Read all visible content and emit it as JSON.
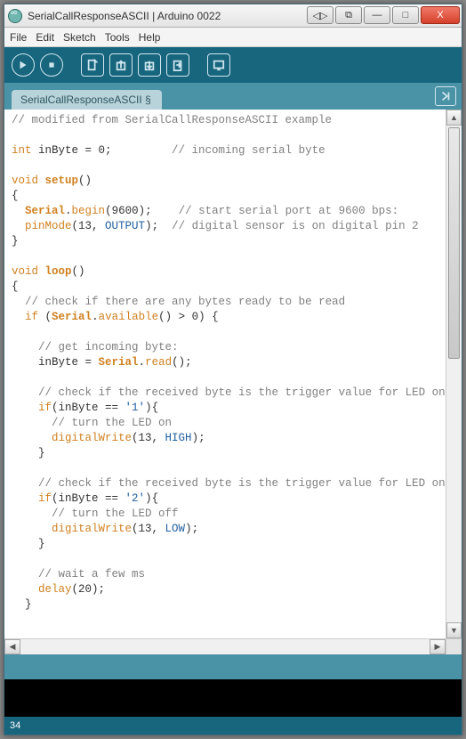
{
  "window": {
    "title": "SerialCallResponseASCII | Arduino 0022"
  },
  "menubar": {
    "file": "File",
    "edit": "Edit",
    "sketch": "Sketch",
    "tools": "Tools",
    "help": "Help"
  },
  "win_buttons": {
    "shrink": "◁▷",
    "expand": "⧉",
    "min": "—",
    "max": "□",
    "close": "X"
  },
  "toolbar_icons": {
    "run": "run-icon",
    "stop": "stop-icon",
    "new": "new-icon",
    "open": "open-icon",
    "save": "save-icon",
    "upload": "upload-icon",
    "serial": "serial-monitor-icon"
  },
  "tab": {
    "label": "SerialCallResponseASCII §"
  },
  "code": {
    "l1": "// modified from SerialCallResponseASCII example",
    "l2_a": "int",
    "l2_b": " inByte = 0;         ",
    "l2_c": "// incoming serial byte",
    "l3_a": "void",
    "l3_b": "setup",
    "l3_c": "()",
    "l4": "{",
    "l5_a": "Serial",
    "l5_b": ".",
    "l5_c": "begin",
    "l5_d": "(9600);    ",
    "l5_e": "// start serial port at 9600 bps:",
    "l6_a": "pinMode",
    "l6_b": "(13, ",
    "l6_c": "OUTPUT",
    "l6_d": ");  ",
    "l6_e": "// digital sensor is on digital pin 2",
    "l7": "}",
    "l8_a": "void",
    "l8_b": "loop",
    "l8_c": "()",
    "l9": "{",
    "l10": "// check if there are any bytes ready to be read",
    "l11_a": "if",
    "l11_b": " (",
    "l11_c": "Serial",
    "l11_d": ".",
    "l11_e": "available",
    "l11_f": "() > 0) {",
    "l12": "// get incoming byte:",
    "l13_a": "    inByte = ",
    "l13_b": "Serial",
    "l13_c": ".",
    "l13_d": "read",
    "l13_e": "();",
    "l14": "// check if the received byte is the trigger value for LED on",
    "l15_a": "if",
    "l15_b": "(inByte == ",
    "l15_c": "'1'",
    "l15_d": "){",
    "l16": "// turn the LED on",
    "l17_a": "digitalWrite",
    "l17_b": "(13, ",
    "l17_c": "HIGH",
    "l17_d": ");",
    "l18": "    }",
    "l19": "// check if the received byte is the trigger value for LED on",
    "l20_a": "if",
    "l20_b": "(inByte == ",
    "l20_c": "'2'",
    "l20_d": "){",
    "l21": "// turn the LED off",
    "l22_a": "digitalWrite",
    "l22_b": "(13, ",
    "l22_c": "LOW",
    "l22_d": ");",
    "l23": "    }",
    "l24": "// wait a few ms",
    "l25_a": "delay",
    "l25_b": "(20);",
    "l26": "  }"
  },
  "status": {
    "line": "34"
  }
}
